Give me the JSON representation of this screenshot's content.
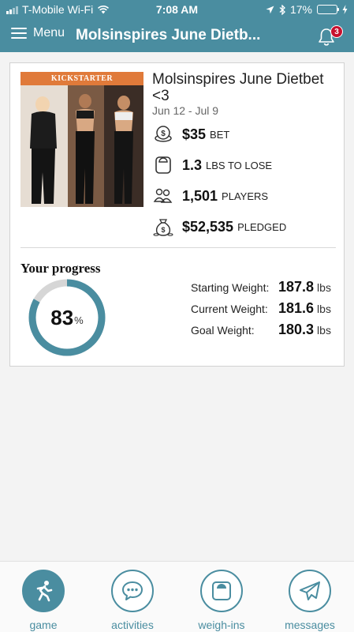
{
  "status_bar": {
    "carrier": "T-Mobile Wi-Fi",
    "time": "7:08 AM",
    "battery": "17%",
    "battery_level": 0.17
  },
  "nav": {
    "menu_label": "Menu",
    "title": "Molsinspires June Dietb...",
    "notification_count": "3"
  },
  "game": {
    "banner": "KICKSTARTER",
    "title": "Molsinspires June Dietbet <3",
    "dates": "Jun 12 - Jul 9",
    "stats": [
      {
        "icon": "coins-icon",
        "value": "$35",
        "unit": "BET"
      },
      {
        "icon": "scale-icon",
        "value": "1.3",
        "unit": "LBS TO LOSE"
      },
      {
        "icon": "players-icon",
        "value": "1,501",
        "unit": "PLAYERS"
      },
      {
        "icon": "money-bag-icon",
        "value": "$52,535",
        "unit": "PLEDGED"
      }
    ]
  },
  "progress": {
    "label": "Your progress",
    "percent": "83",
    "percent_sign": "%",
    "percent_value": 83,
    "weights": [
      {
        "label": "Starting Weight:",
        "value": "187.8",
        "unit": "lbs"
      },
      {
        "label": "Current Weight:",
        "value": "181.6",
        "unit": "lbs"
      },
      {
        "label": "Goal Weight:",
        "value": "180.3",
        "unit": "lbs"
      }
    ]
  },
  "tabs": [
    {
      "label": "game",
      "icon": "runner-icon",
      "active": true
    },
    {
      "label": "activities",
      "icon": "chat-bubble-icon",
      "active": false
    },
    {
      "label": "weigh-ins",
      "icon": "scale-icon",
      "active": false
    },
    {
      "label": "messages",
      "icon": "paper-plane-icon",
      "active": false
    }
  ],
  "colors": {
    "primary": "#4a8da0",
    "badge": "#c8102e",
    "battery_low": "#e8413c",
    "ring_track": "#d6d6d6"
  }
}
